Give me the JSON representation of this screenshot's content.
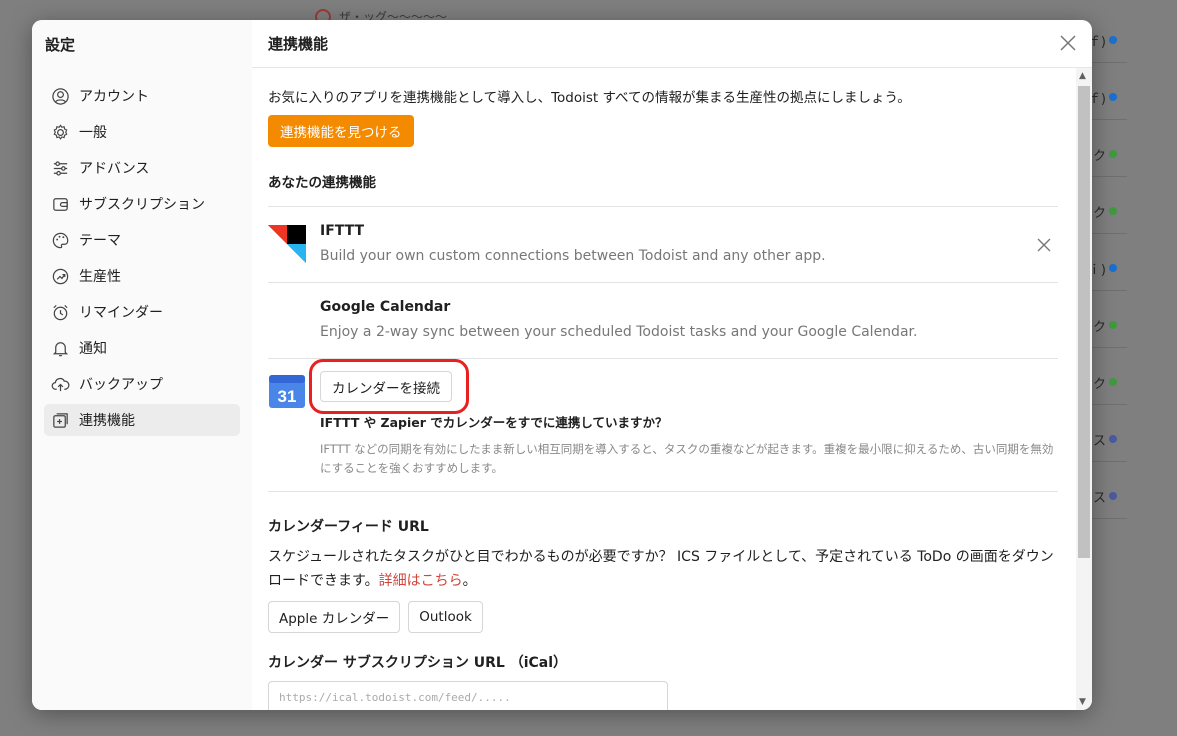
{
  "sidebar": {
    "title": "設定",
    "items": [
      {
        "label": "アカウント",
        "icon": "account-icon"
      },
      {
        "label": "一般",
        "icon": "gear-icon"
      },
      {
        "label": "アドバンス",
        "icon": "sliders-icon"
      },
      {
        "label": "サブスクリプション",
        "icon": "wallet-icon"
      },
      {
        "label": "テーマ",
        "icon": "palette-icon"
      },
      {
        "label": "生産性",
        "icon": "productivity-icon"
      },
      {
        "label": "リマインダー",
        "icon": "alarm-icon"
      },
      {
        "label": "通知",
        "icon": "bell-icon"
      },
      {
        "label": "バックアップ",
        "icon": "cloud-upload-icon"
      },
      {
        "label": "連携機能",
        "icon": "integrations-icon"
      }
    ],
    "active_index": 9
  },
  "main": {
    "title": "連携機能",
    "intro": "お気に入りのアプリを連携機能として導入し、Todoist すべての情報が集まる生産性の拠点にしましょう。",
    "discover_button": "連携機能を見つける",
    "your_integrations_title": "あなたの連携機能",
    "integrations": [
      {
        "name": "IFTTT",
        "description": "Build your own custom connections between Todoist and any other app."
      },
      {
        "name": "Google Calendar",
        "description": "Enjoy a 2-way sync between your scheduled Todoist tasks and your Google Calendar."
      }
    ],
    "gcal": {
      "connect_button": "カレンダーを接続",
      "calendar_day": "31",
      "question": "IFTTT や Zapier でカレンダーをすでに連携していますか？",
      "warning": "IFTTT などの同期を有効にしたまま新しい相互同期を導入すると、タスクの重複などが起きます。重複を最小限に抑えるため、古い同期を無効にすることを強くおすすめします。"
    },
    "feed": {
      "title": "カレンダーフィード URL",
      "description": "スケジュールされたタスクがひと目でわかるものが必要ですか？ ICS ファイルとして、予定されている ToDo の画面をダウンロードできます。",
      "link": "詳細はこちら",
      "link_suffix": "。",
      "apple_button": "Apple カレンダー",
      "outlook_button": "Outlook"
    },
    "ical": {
      "title": "カレンダー サブスクリプション URL （iCal）",
      "value": "https://ical.todoist.com/feed/....."
    }
  },
  "background": {
    "top_text": "ザ・ッグ～～～～～",
    "rows": [
      {
        "text": "ｆ)",
        "color": "#1a6fd1"
      },
      {
        "text": "ｆ)",
        "color": "#1a6fd1"
      },
      {
        "text": "ク",
        "color": "#3f9a3f"
      },
      {
        "text": "ク",
        "color": "#3f9a3f"
      },
      {
        "text": "ｉ)",
        "color": "#1a6fd1"
      },
      {
        "text": "ク",
        "color": "#3f9a3f"
      },
      {
        "text": "ク",
        "color": "#3f9a3f"
      },
      {
        "text": "ス",
        "color": "#4a5aa0"
      },
      {
        "text": "ス",
        "color": "#4a5aa0"
      }
    ]
  },
  "colors": {
    "accent": "#f48a00",
    "link": "#d1453b",
    "annotation": "#e8201f"
  }
}
